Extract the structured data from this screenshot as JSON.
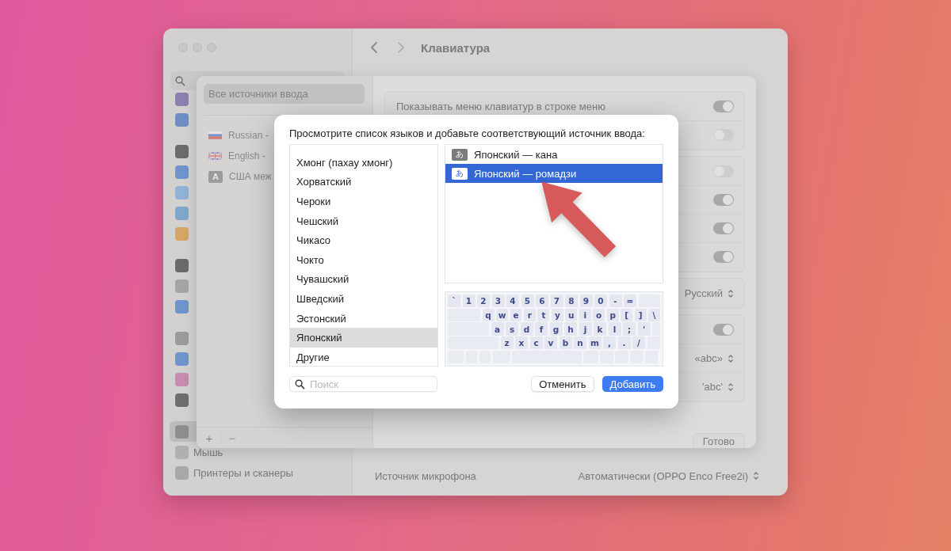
{
  "window": {
    "title": "Клавиатура",
    "sidebar": {
      "items": [
        {
          "color": "#8a7fae",
          "selected": false
        },
        {
          "color": "#6f8fc4",
          "selected": false
        },
        {
          "color": "#6b6b6b",
          "selected": false
        },
        {
          "color": "#6f93cc",
          "selected": false
        },
        {
          "color": "#8fb2d6",
          "selected": false
        },
        {
          "color": "#7ea7c9",
          "selected": false
        },
        {
          "color": "#d3a566",
          "selected": false
        },
        {
          "color": "#6a6a6a",
          "selected": false
        },
        {
          "color": "#a5a5a5",
          "selected": false
        },
        {
          "color": "#6f93cc",
          "selected": false
        },
        {
          "color": "#9a9a9a",
          "selected": false
        },
        {
          "color": "#6f93cc",
          "selected": false
        },
        {
          "color": "#c58bb0",
          "selected": false
        },
        {
          "color": "#6e6e6e",
          "selected": false
        },
        {
          "color": "#8e8e8e",
          "selected": true
        },
        {
          "color": "#b0b0b0",
          "label": "Мышь",
          "selected": false
        },
        {
          "color": "#a8a8a8",
          "label": "Принтеры и сканеры",
          "selected": false
        }
      ]
    },
    "settings": [
      {
        "label": "Источник микрофона",
        "value": "Автоматически (OPPO Enco Free2i)"
      }
    ]
  },
  "sheet": {
    "sources_header": {
      "label": "Все источники ввода",
      "selected": true
    },
    "sources": [
      {
        "kind": "flag-ru",
        "label": "Russian -"
      },
      {
        "kind": "flag-uk",
        "label": "English -"
      },
      {
        "kind": "letter",
        "letter": "A",
        "label": "США меж"
      }
    ],
    "add_button": "+",
    "remove_button": "−",
    "groups": [
      [
        {
          "kind": "toggle",
          "label": "Показывать меню клавиатур в строке меню",
          "on": true
        },
        {
          "kind": "toggle",
          "on": false
        }
      ],
      [
        {
          "kind": "toggle",
          "on": false
        },
        {
          "kind": "toggle",
          "on": true
        },
        {
          "kind": "toggle",
          "on": true
        },
        {
          "kind": "toggle",
          "on": true
        }
      ],
      [
        {
          "kind": "select",
          "value": "Русский"
        }
      ],
      [
        {
          "kind": "toggle",
          "on": true
        },
        {
          "kind": "select",
          "value": "«abc»"
        },
        {
          "kind": "select",
          "value": "'abc'"
        }
      ]
    ],
    "done_button": "Готово"
  },
  "dialog": {
    "prompt": "Просмотрите список языков и добавьте соответствующий источник ввода:",
    "languages": [
      {
        "label": "Хмонг (пахау хмонг)",
        "selected": false
      },
      {
        "label": "Хорватский",
        "selected": false
      },
      {
        "label": "Чероки",
        "selected": false
      },
      {
        "label": "Чешский",
        "selected": false
      },
      {
        "label": "Чикасо",
        "selected": false
      },
      {
        "label": "Чокто",
        "selected": false
      },
      {
        "label": "Чувашский",
        "selected": false
      },
      {
        "label": "Шведский",
        "selected": false
      },
      {
        "label": "Эстонский",
        "selected": false
      },
      {
        "label": "Японский",
        "selected": true
      },
      {
        "label": "Другие",
        "selected": false
      }
    ],
    "sources": [
      {
        "glyph": "あ",
        "label": "Японский — кана",
        "selected": false
      },
      {
        "glyph": "あ",
        "label": "Японский — ромадзи",
        "selected": true
      }
    ],
    "keyboard": [
      [
        "`",
        "1",
        "2",
        "3",
        "4",
        "5",
        "6",
        "7",
        "8",
        "9",
        "0",
        "-",
        "="
      ],
      [
        "q",
        "w",
        "e",
        "r",
        "t",
        "y",
        "u",
        "i",
        "o",
        "p",
        "[",
        "]",
        "\\"
      ],
      [
        "a",
        "s",
        "d",
        "f",
        "g",
        "h",
        "j",
        "k",
        "l",
        ";",
        "'"
      ],
      [
        "z",
        "x",
        "c",
        "v",
        "b",
        "n",
        "m",
        ",",
        ".",
        "/"
      ]
    ],
    "search": {
      "placeholder": "Поиск"
    },
    "cancel_button": "Отменить",
    "add_button": "Добавить"
  }
}
